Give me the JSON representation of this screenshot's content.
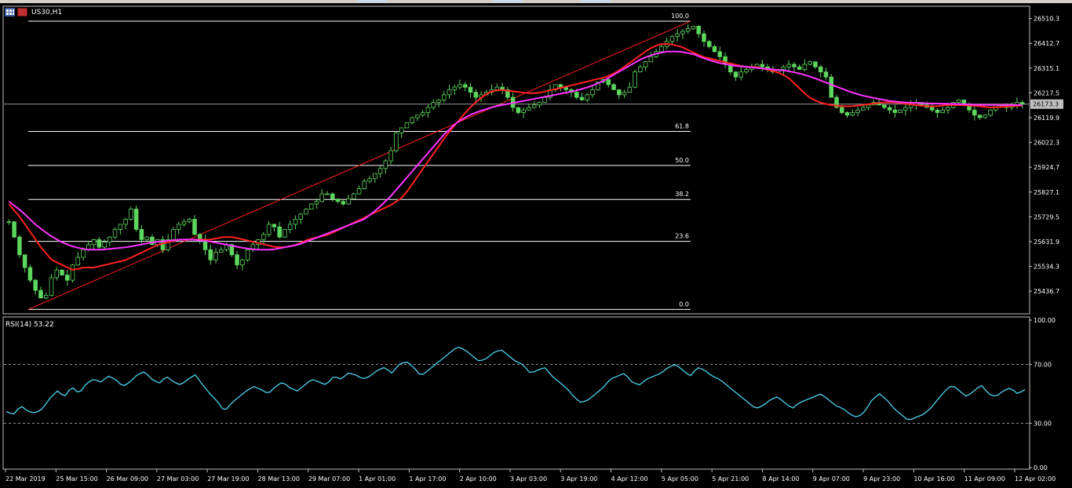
{
  "window": {
    "symbol_label": "US30,H1"
  },
  "price_axis": {
    "min": 25360,
    "max": 26540,
    "ticks": [
      "26510.3",
      "26412.7",
      "26315.1",
      "26217.5",
      "26119.9",
      "26022.3",
      "25924.7",
      "25827.1",
      "25729.5",
      "25631.9",
      "25534.3",
      "25436.7"
    ],
    "current_price": "26173.3"
  },
  "fibonacci": {
    "levels": [
      {
        "label": "100.0",
        "price": 26500
      },
      {
        "label": "61.8",
        "price": 26066
      },
      {
        "label": "50.0",
        "price": 25932
      },
      {
        "label": "38.2",
        "price": 25798
      },
      {
        "label": "23.6",
        "price": 25633
      },
      {
        "label": "0.0",
        "price": 25365
      }
    ]
  },
  "rsi": {
    "label": "RSI(14) 53.22",
    "ticks": [
      "100.00",
      "70.00",
      "30.00",
      "0.00"
    ],
    "levels": [
      70,
      30
    ],
    "color": "#4dd3f0"
  },
  "time_axis": {
    "labels": [
      "22 Mar 2019",
      "25 Mar 15:00",
      "26 Mar 09:00",
      "27 Mar 03:00",
      "27 Mar 19:00",
      "28 Mar 13:00",
      "29 Mar 07:00",
      "1 Apr 01:00",
      "1 Apr 17:00",
      "2 Apr 10:00",
      "3 Apr 03:00",
      "3 Apr 19:00",
      "4 Apr 12:00",
      "5 Apr 05:00",
      "5 Apr 21:00",
      "8 Apr 14:00",
      "9 Apr 07:00",
      "9 Apr 23:00",
      "10 Apr 16:00",
      "11 Apr 09:00",
      "12 Apr 02:00"
    ]
  },
  "colors": {
    "background": "#000000",
    "candle": "#5cd65c",
    "ma_fast": "#ff2020",
    "ma_slow": "#ff33ff",
    "fib_lines": "#ffffff",
    "trend_line": "#ff2020",
    "price_line": "#aaaaaa"
  },
  "chart_data": [
    {
      "type": "line",
      "title": "US30,H1",
      "xlabel": "",
      "ylabel": "",
      "ylim": [
        25360,
        26540
      ],
      "series": [
        {
          "values": [
            25710,
            25650,
            25580,
            25530,
            25480,
            25440,
            25410,
            25420,
            25490,
            25520,
            25500,
            25480,
            25540,
            25570,
            25600,
            25620,
            25640,
            25610,
            25630,
            25650,
            25680,
            25700,
            25720,
            25760,
            25680,
            25640,
            25650,
            25620,
            25640,
            25600,
            25640,
            25680,
            25700,
            25710,
            25720,
            25660,
            25640,
            25600,
            25560,
            25590,
            25600,
            25620,
            25580,
            25540,
            25560,
            25600,
            25620,
            25640,
            25660,
            25700,
            25690,
            25650,
            25680,
            25700,
            25720,
            25740,
            25760,
            25780,
            25790,
            25820,
            25820,
            25800,
            25790,
            25780,
            25800,
            25820,
            25840,
            25870,
            25880,
            25900,
            25920,
            25950,
            25990,
            26060,
            26080,
            26100,
            26120,
            26130,
            26140,
            26160,
            26180,
            26190,
            26210,
            26230,
            26240,
            26250,
            26240,
            26220,
            26200,
            26210,
            26220,
            26230,
            26240,
            26230,
            26200,
            26160,
            26140,
            26150,
            26160,
            26170,
            26180,
            26200,
            26230,
            26250,
            26240,
            26230,
            26220,
            26200,
            26190,
            26210,
            26230,
            26260,
            26270,
            26250,
            26230,
            26210,
            26220,
            26240,
            26300,
            26320,
            26340,
            26360,
            26380,
            26400,
            26420,
            26440,
            26450,
            26460,
            26470,
            26480,
            26450,
            26420,
            26400,
            26380,
            26360,
            26330,
            26300,
            26280,
            26300,
            26310,
            26320,
            26330,
            26320,
            26310,
            26300,
            26310,
            26320,
            26330,
            26320,
            26310,
            26330,
            26340,
            26320,
            26300,
            26280,
            26200,
            26160,
            26140,
            26130,
            26140,
            26150,
            26160,
            26170,
            26180,
            26170,
            26160,
            26150,
            26140,
            26150,
            26160,
            26170,
            26180,
            26170,
            26160,
            26150,
            26140,
            26150,
            26160,
            26180,
            26190,
            26170,
            26150,
            26130,
            26120,
            26130,
            26150,
            26170,
            26170,
            26160,
            26170,
            26180,
            26173
          ]
        },
        {
          "name": "MA fast",
          "values": [
            25780,
            25730,
            25670,
            25610,
            25560,
            25540,
            25520,
            25530,
            25530,
            25540,
            25550,
            25560,
            25580,
            25600,
            25620,
            25630,
            25640,
            25640,
            25640,
            25640,
            25650,
            25650,
            25640,
            25630,
            25620,
            25610,
            25610,
            25620,
            25640,
            25650,
            25660,
            25680,
            25700,
            25720,
            25740,
            25760,
            25780,
            25810,
            25870,
            25930,
            25990,
            26050,
            26100,
            26150,
            26190,
            26220,
            26230,
            26225,
            26220,
            26215,
            26220,
            26230,
            26240,
            26250,
            26260,
            26270,
            26280,
            26300,
            26330,
            26360,
            26390,
            26410,
            26410,
            26400,
            26380,
            26360,
            26350,
            26340,
            26330,
            26320,
            26320,
            26310,
            26300,
            26280,
            26240,
            26200,
            26180,
            26170,
            26165,
            26165,
            26170,
            26175,
            26180,
            26180,
            26175,
            26170,
            26165,
            26165,
            26170,
            26170,
            26168,
            26165,
            26160,
            26162,
            26165,
            26168
          ]
        },
        {
          "name": "MA slow",
          "values": [
            25790,
            25750,
            25700,
            25660,
            25630,
            25610,
            25600,
            25600,
            25605,
            25610,
            25620,
            25630,
            25635,
            25640,
            25640,
            25635,
            25625,
            25615,
            25605,
            25600,
            25600,
            25610,
            25620,
            25640,
            25660,
            25680,
            25700,
            25720,
            25760,
            25810,
            25870,
            25930,
            25990,
            26050,
            26100,
            26130,
            26150,
            26165,
            26175,
            26185,
            26195,
            26205,
            26215,
            26225,
            26240,
            26260,
            26290,
            26320,
            26350,
            26370,
            26380,
            26380,
            26370,
            26350,
            26335,
            26325,
            26320,
            26315,
            26310,
            26305,
            26295,
            26280,
            26260,
            26240,
            26220,
            26205,
            26195,
            26185,
            26180,
            26178,
            26176,
            26175,
            26174,
            26172,
            26170,
            26170,
            26170,
            26170
          ]
        }
      ]
    },
    {
      "type": "line",
      "title": "RSI(14) 53.22",
      "ylim": [
        0,
        100
      ],
      "series": [
        {
          "values": [
            38,
            36,
            42,
            38,
            37,
            40,
            47,
            52,
            48,
            55,
            50,
            57,
            60,
            58,
            62,
            60,
            55,
            58,
            63,
            65,
            60,
            57,
            62,
            58,
            56,
            60,
            63,
            56,
            50,
            45,
            38,
            44,
            48,
            52,
            55,
            53,
            50,
            55,
            58,
            54,
            52,
            56,
            60,
            58,
            56,
            62,
            60,
            64,
            63,
            60,
            62,
            66,
            68,
            64,
            70,
            72,
            68,
            62,
            66,
            70,
            74,
            78,
            82,
            80,
            76,
            72,
            74,
            78,
            80,
            76,
            72,
            70,
            64,
            66,
            68,
            62,
            58,
            54,
            48,
            44,
            46,
            50,
            54,
            60,
            62,
            64,
            58,
            56,
            60,
            62,
            64,
            68,
            70,
            66,
            62,
            68,
            66,
            62,
            60,
            56,
            52,
            48,
            44,
            40,
            42,
            46,
            48,
            44,
            40,
            44,
            46,
            48,
            50,
            46,
            42,
            40,
            36,
            34,
            38,
            46,
            50,
            46,
            40,
            36,
            32,
            34,
            36,
            40,
            46,
            52,
            56,
            52,
            48,
            52,
            56,
            50,
            48,
            52,
            54,
            50,
            53
          ]
        }
      ]
    }
  ]
}
